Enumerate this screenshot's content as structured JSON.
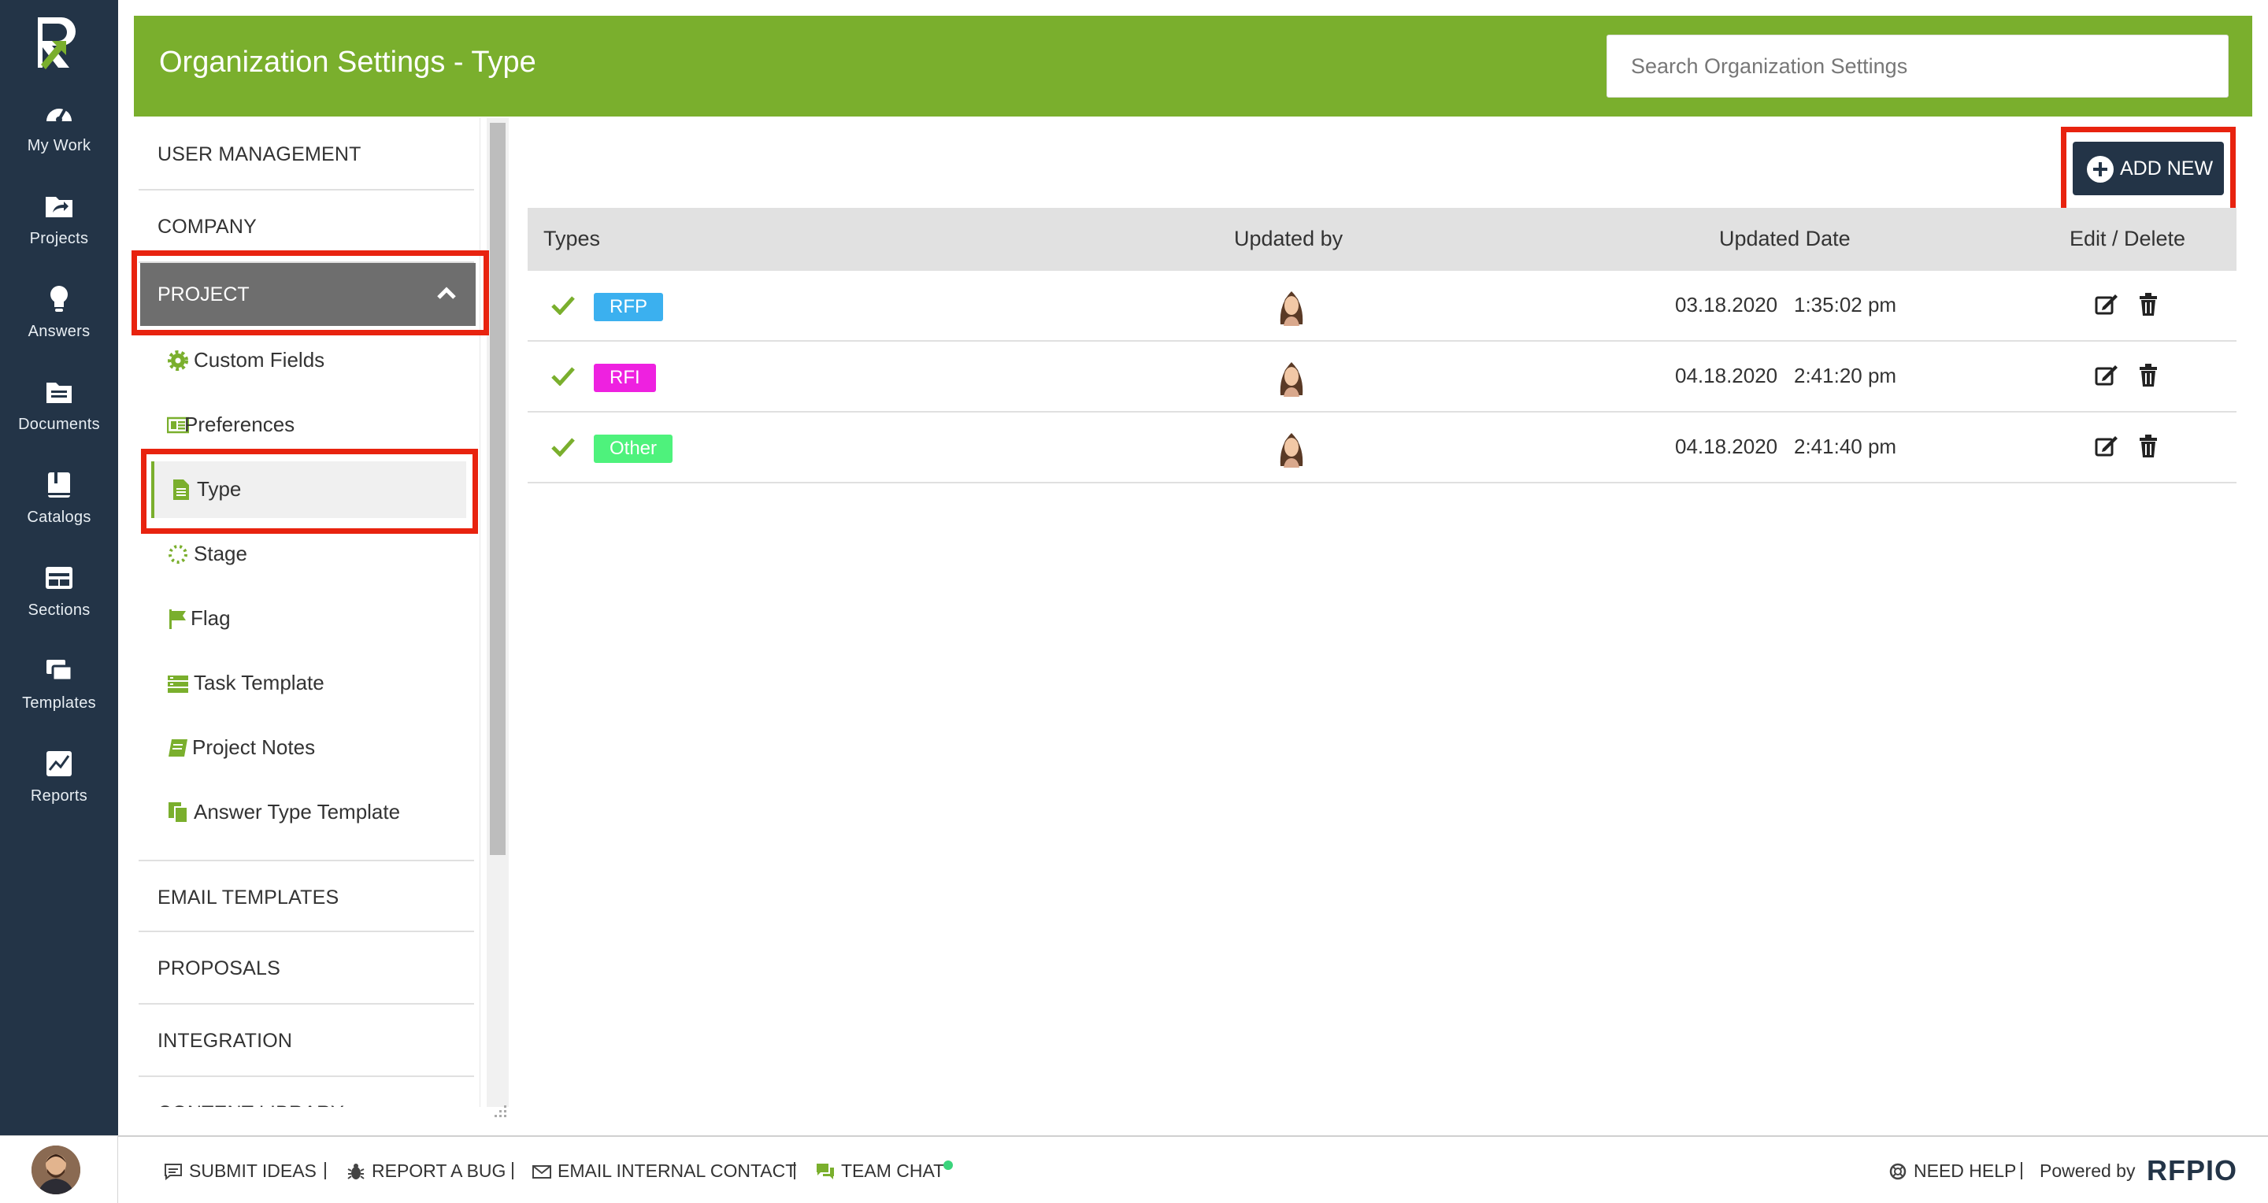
{
  "colors": {
    "nav_bg": "#233447",
    "header_green": "#7aaf2d",
    "highlight_red": "#e8230f",
    "rfp_badge": "#3bb0ef",
    "rfi_badge": "#ee21e0",
    "other_badge": "#4ef27c"
  },
  "nav": {
    "items": [
      {
        "label": "My Work",
        "icon": "speedometer-icon"
      },
      {
        "label": "Projects",
        "icon": "folder-share-icon"
      },
      {
        "label": "Answers",
        "icon": "lightbulb-icon"
      },
      {
        "label": "Documents",
        "icon": "documents-icon"
      },
      {
        "label": "Catalogs",
        "icon": "book-icon"
      },
      {
        "label": "Sections",
        "icon": "sections-icon"
      },
      {
        "label": "Templates",
        "icon": "templates-icon"
      },
      {
        "label": "Reports",
        "icon": "chart-icon"
      }
    ]
  },
  "header": {
    "title": "Organization Settings - Type",
    "search_placeholder": "Search Organization Settings"
  },
  "settings_menu": {
    "user_management": "USER MANAGEMENT",
    "company": "COMPANY",
    "project": "PROJECT",
    "sub_items": [
      {
        "label": "Custom Fields",
        "icon": "gear-icon"
      },
      {
        "label": "Preferences",
        "icon": "preferences-icon"
      },
      {
        "label": "Type",
        "icon": "document-icon"
      },
      {
        "label": "Stage",
        "icon": "spinner-icon"
      },
      {
        "label": "Flag",
        "icon": "flag-icon"
      },
      {
        "label": "Task Template",
        "icon": "task-template-icon"
      },
      {
        "label": "Project Notes",
        "icon": "notes-icon"
      },
      {
        "label": "Answer Type Template",
        "icon": "answer-template-icon"
      }
    ],
    "email_templates": "EMAIL TEMPLATES",
    "proposals": "PROPOSALS",
    "integration": "INTEGRATION",
    "content_library": "CONTENT LIBRARY"
  },
  "toolbar": {
    "add_new_label": "ADD NEW"
  },
  "table": {
    "headers": {
      "types": "Types",
      "updated_by": "Updated by",
      "updated_date": "Updated Date",
      "edit_delete": "Edit / Delete"
    },
    "rows": [
      {
        "type": "RFP",
        "date": "03.18.2020",
        "time": "1:35:02 pm"
      },
      {
        "type": "RFI",
        "date": "04.18.2020",
        "time": "2:41:20 pm"
      },
      {
        "type": "Other",
        "date": "04.18.2020",
        "time": "2:41:40 pm"
      }
    ]
  },
  "footer": {
    "submit_ideas": "SUBMIT IDEAS",
    "report_bug": "REPORT A BUG",
    "email_contact": "EMAIL INTERNAL CONTACT",
    "team_chat": "TEAM CHAT",
    "need_help": "NEED HELP",
    "powered_by": "Powered by",
    "brand": "RFPIO"
  }
}
